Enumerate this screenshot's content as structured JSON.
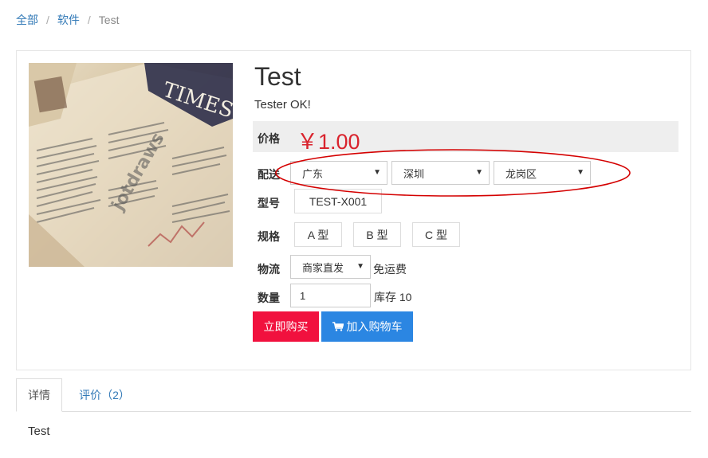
{
  "breadcrumb": {
    "items": [
      "全部",
      "软件"
    ],
    "current": "Test",
    "separator": "/"
  },
  "product": {
    "title": "Test",
    "subtitle": "Tester OK!",
    "price_label": "价格",
    "price": "￥1.00",
    "image_alt": "newspaper product photo"
  },
  "shipping": {
    "label": "配送",
    "province": "广东",
    "city": "深圳",
    "district": "龙岗区"
  },
  "model": {
    "label": "型号",
    "value": "TEST-X001"
  },
  "spec": {
    "label": "规格",
    "options": [
      "A 型",
      "B 型",
      "C 型"
    ]
  },
  "logistics": {
    "label": "物流",
    "method": "商家直发",
    "note": "免运费"
  },
  "quantity": {
    "label": "数量",
    "value": "1",
    "stock": "库存 10"
  },
  "actions": {
    "buy_now": "立即购买",
    "add_to_cart": "加入购物车"
  },
  "tabs": {
    "details": "详情",
    "reviews": "评价（2）",
    "content": "Test"
  },
  "colors": {
    "price": "#d9232d",
    "buy_button": "#f1113e",
    "cart_button": "#2b86e2",
    "link": "#337ab7",
    "annotation": "#d40000"
  }
}
